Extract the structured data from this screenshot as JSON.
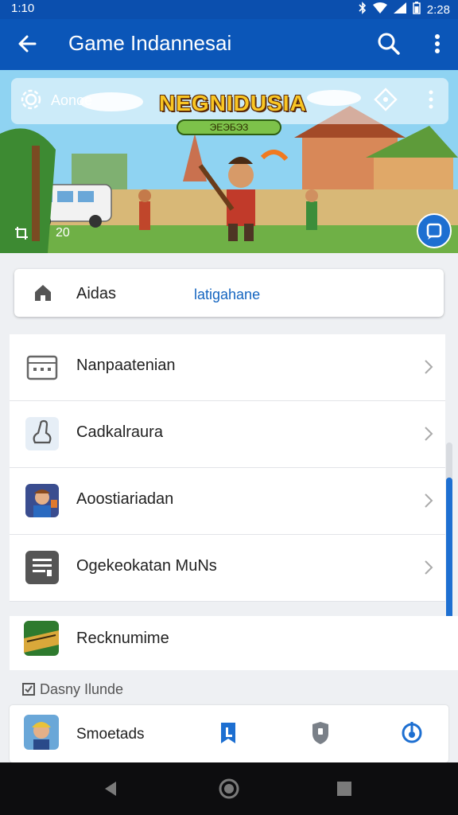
{
  "status_bar": {
    "time_left": "1:10",
    "time_right": "2:28"
  },
  "app_bar": {
    "title": "Game Indannesai"
  },
  "banner": {
    "account_label": "Aonoe",
    "game_title": "NEGNIDUSIA",
    "sub_badge": "ЭЕЭБЭЗ",
    "count": "20"
  },
  "tabs": {
    "tab1": "Aidas",
    "tab2": "latigahane"
  },
  "list": {
    "items": [
      {
        "label": "Nanpaatenian",
        "icon": "calendar-icon"
      },
      {
        "label": "Cadkalraura",
        "icon": "bag-icon"
      },
      {
        "label": "Aoostiariadan",
        "icon": "character-thumbnail"
      },
      {
        "label": "Ogekeokatan MuNs",
        "icon": "document-icon"
      }
    ]
  },
  "single_item": {
    "label": "Recknumime",
    "icon": "game-thumbnail"
  },
  "section_header": "Dasny Ilunde",
  "bottom_item": {
    "label": "Smoetads",
    "actions": [
      "bookmark-icon",
      "shield-icon",
      "power-icon"
    ]
  },
  "colors": {
    "primary": "#0b56b8",
    "accent": "#1d6fd1"
  }
}
